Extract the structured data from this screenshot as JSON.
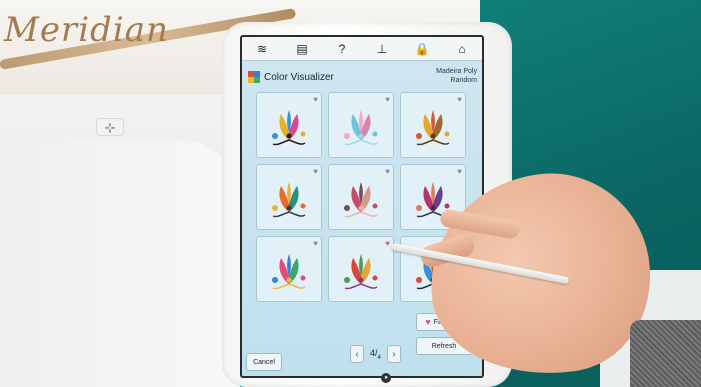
{
  "machine": {
    "brand_text": "Meridian",
    "needle_glyph": "⊹"
  },
  "statusbar": {
    "icons": [
      "wifi-icon",
      "document-icon",
      "help-icon",
      "stitch-icon",
      "lock-icon",
      "home-icon"
    ],
    "glyphs": [
      "≋",
      "▤",
      "?",
      "⊥",
      "🔒",
      "⌂"
    ]
  },
  "app": {
    "title": "Color Visualizer",
    "thread_brand": "Madeira Poly",
    "mode": "Random",
    "logo_colors": [
      "#e24a3b",
      "#3a7fd5",
      "#f2b624",
      "#3fae4f"
    ]
  },
  "designs": [
    {
      "heart_color": "#7c8f99",
      "colors": [
        "#e8b028",
        "#d94a8a",
        "#3a8fd8",
        "#1c1c1c"
      ]
    },
    {
      "heart_color": "#7c8f99",
      "colors": [
        "#6fc4d9",
        "#d883b0",
        "#f3a6c5",
        "#a9d6e5"
      ]
    },
    {
      "heart_color": "#7c8f99",
      "colors": [
        "#e6a52c",
        "#9b6b2f",
        "#d25a34",
        "#5a3b1a"
      ]
    },
    {
      "heart_color": "#7c8f99",
      "colors": [
        "#e76b2b",
        "#2f8d7a",
        "#e4b33b",
        "#3a3a3a"
      ]
    },
    {
      "heart_color": "#7c8f99",
      "colors": [
        "#c84b6a",
        "#d39a8b",
        "#7a4a5a",
        "#e7b7a7"
      ]
    },
    {
      "heart_color": "#7c8f99",
      "colors": [
        "#b8336a",
        "#6a3f8c",
        "#e07a5f",
        "#3d2b55"
      ]
    },
    {
      "heart_color": "#7c8f99",
      "colors": [
        "#e04b7a",
        "#3aa66b",
        "#3b7fd2",
        "#f2b63a"
      ]
    },
    {
      "heart_color": "#e0508f",
      "colors": [
        "#d9463b",
        "#e8a33a",
        "#4a9c4f",
        "#8a3a8a"
      ]
    },
    {
      "heart_color": "#7c8f99",
      "colors": [
        "#3a8fd8",
        "#e8b028",
        "#d94a3a",
        "#2a2a2a"
      ]
    }
  ],
  "buttons": {
    "favorites": "Favorites",
    "refresh": "Refresh",
    "cancel": "Cancel",
    "prev": "‹",
    "next": "›"
  },
  "pager": {
    "current": "4",
    "total": "4"
  },
  "footer": {
    "home_glyph": "●"
  }
}
